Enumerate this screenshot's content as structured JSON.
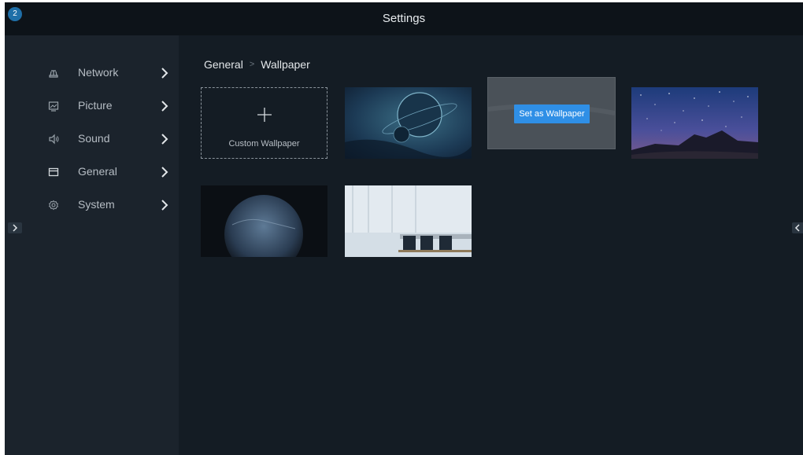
{
  "header": {
    "title": "Settings",
    "badge_count": "2"
  },
  "sidebar": {
    "items": [
      {
        "label": "Network",
        "icon": "network-icon"
      },
      {
        "label": "Picture",
        "icon": "picture-icon"
      },
      {
        "label": "Sound",
        "icon": "speaker-icon"
      },
      {
        "label": "General",
        "icon": "general-icon"
      },
      {
        "label": "System",
        "icon": "system-gear-icon"
      }
    ]
  },
  "breadcrumb": {
    "parent": "General",
    "separator": ">",
    "current": "Wallpaper"
  },
  "wallpapers": {
    "custom_label": "Custom Wallpaper",
    "set_button_label": "Set as Wallpaper",
    "items": [
      {
        "name": "wallpaper-planet-rings",
        "selected": false
      },
      {
        "name": "wallpaper-selected",
        "selected": true
      },
      {
        "name": "wallpaper-starry-sky",
        "selected": false
      },
      {
        "name": "wallpaper-earth-dark",
        "selected": false
      },
      {
        "name": "wallpaper-meeting-room",
        "selected": false
      }
    ]
  },
  "colors": {
    "background": "#141c24",
    "sidebar": "#1b232c",
    "titlebar": "#0d1319",
    "accent": "#2f8fe6",
    "badge": "#1f6fa8"
  }
}
